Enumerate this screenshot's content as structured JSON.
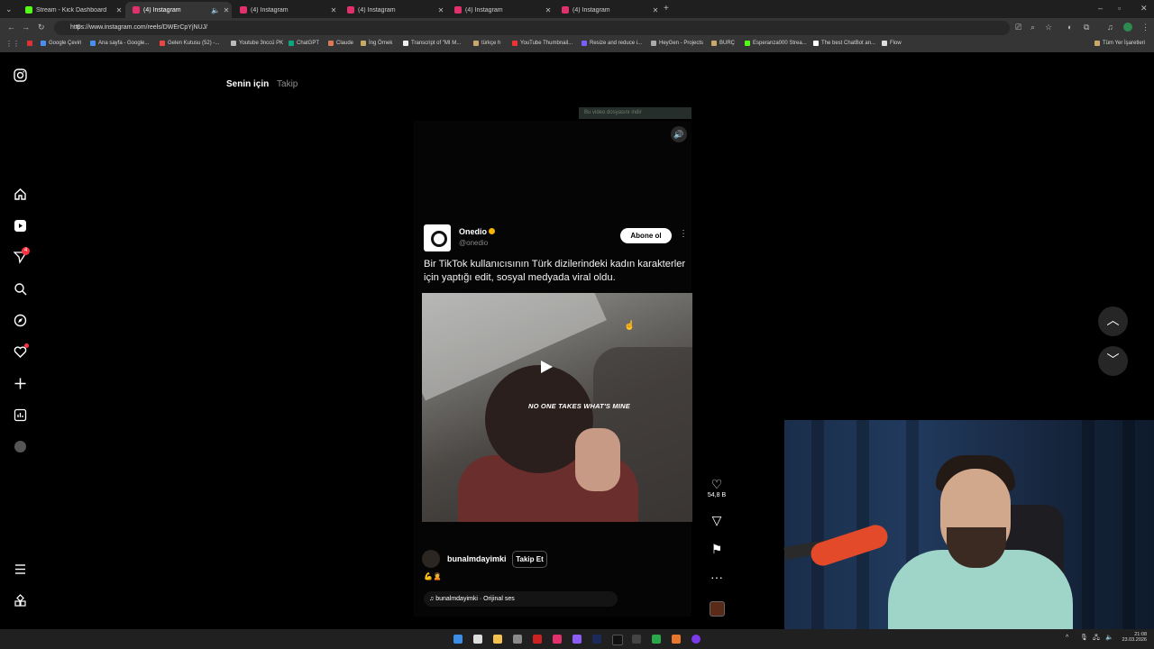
{
  "browser": {
    "tabs": [
      {
        "title": "Stream - Kick Dashboard",
        "color": "#53fc18"
      },
      {
        "title": "(4) Instagram",
        "color": "#e1306c",
        "active": true
      },
      {
        "title": "(4) Instagram",
        "color": "#e1306c"
      },
      {
        "title": "(4) Instagram",
        "color": "#e1306c"
      },
      {
        "title": "(4) Instagram",
        "color": "#e1306c"
      },
      {
        "title": "(4) Instagram",
        "color": "#e1306c"
      }
    ],
    "url": "https://www.instagram.com/reels/DWErCpYjNUJ/",
    "bookmarks": [
      "Google Çeviri",
      "Ana sayfa - Google...",
      "Gelen Kutusu (52) -...",
      "Youtube 3nccü PK",
      "ChatGPT",
      "Claude",
      "İng Örnek",
      "Transcript of \"MI M...",
      "türkçe h",
      "YouTube Thumbnail...",
      "Resize and reduce i...",
      "HeyGen - Projects",
      "BURÇ",
      "Esperanza000 Strea...",
      "The best ChatBot an...",
      "Flow"
    ],
    "all_bookmarks": "Tüm Yer İşaretleri",
    "new_tab_icon": "plus-icon"
  },
  "feed_tabs": {
    "for_you": "Senin için",
    "following": "Takip"
  },
  "sidebar": {
    "notification_count": "4",
    "icons": [
      "instagram-logo-icon",
      "home-icon",
      "reels-icon",
      "messages-icon",
      "search-icon",
      "explore-icon",
      "notifications-icon",
      "create-icon",
      "dashboard-icon",
      "profile-icon",
      "menu-icon",
      "meta-icon"
    ]
  },
  "reel": {
    "banner": "Bu video dosyasını indir",
    "tweet": {
      "name": "Onedio",
      "handle": "@onedio",
      "subscribe": "Abone ol",
      "text": "Bir TikTok kullanıcısının Türk dizilerindeki kadın karakterler için yaptığı edit, sosyal medyada viral oldu."
    },
    "video_caption": "NO ONE TAKES WHAT'S MINE",
    "user": "bunalmdayimki",
    "follow": "Takip Et",
    "emojis": "💪🙎",
    "audio": "♫ bunalmdayimki · Orijinal ses",
    "likes": "54,8 B"
  },
  "taskbar": {
    "time": "21:08",
    "date": "23.03.2026"
  }
}
